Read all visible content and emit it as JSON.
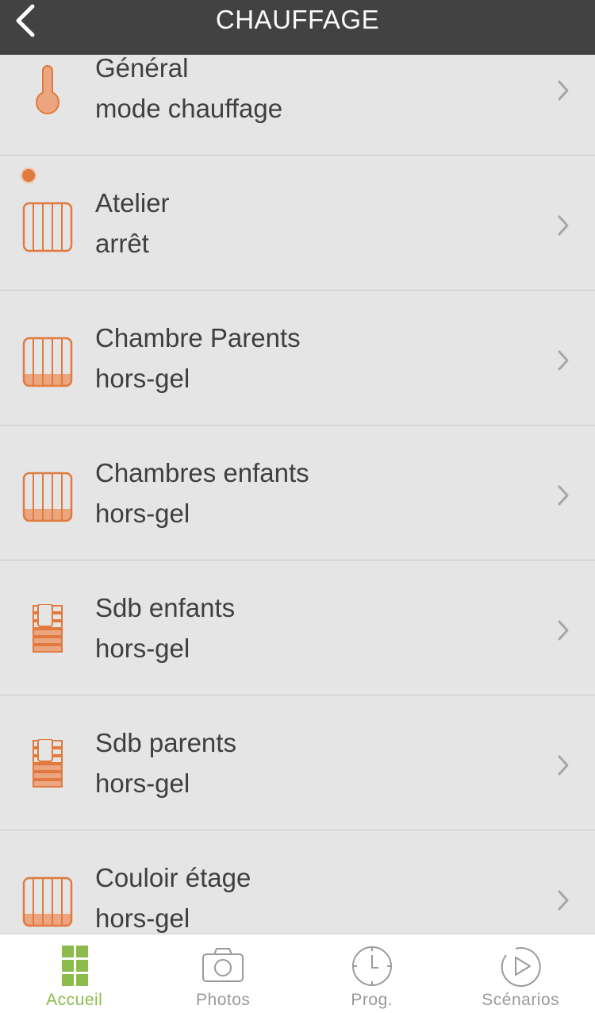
{
  "header": {
    "title": "CHAUFFAGE"
  },
  "rows": [
    {
      "name": "Général",
      "status": "mode chauffage",
      "icon": "thermometer-icon"
    },
    {
      "name": "Atelier",
      "status": "arrêt",
      "icon": "radiator-icon",
      "alert": true
    },
    {
      "name": "Chambre Parents",
      "status": "hors-gel",
      "icon": "radiator-icon"
    },
    {
      "name": "Chambres enfants",
      "status": "hors-gel",
      "icon": "radiator-icon"
    },
    {
      "name": "Sdb enfants",
      "status": "hors-gel",
      "icon": "towel-radiator-icon"
    },
    {
      "name": "Sdb parents",
      "status": "hors-gel",
      "icon": "towel-radiator-icon"
    },
    {
      "name": "Couloir étage",
      "status": "hors-gel",
      "icon": "radiator-icon"
    }
  ],
  "tabs": [
    {
      "label": "Accueil",
      "icon": "grid-icon",
      "active": true
    },
    {
      "label": "Photos",
      "icon": "camera-icon",
      "active": false
    },
    {
      "label": "Prog.",
      "icon": "clock-icon",
      "active": false
    },
    {
      "label": "Scénarios",
      "icon": "play-icon",
      "active": false
    }
  ],
  "colors": {
    "header_bg": "#424242",
    "list_bg": "#e5e5e5",
    "accent_orange": "#e07a3e",
    "accent_green": "#8dbb4c",
    "tab_inactive": "#9a9a9a"
  }
}
